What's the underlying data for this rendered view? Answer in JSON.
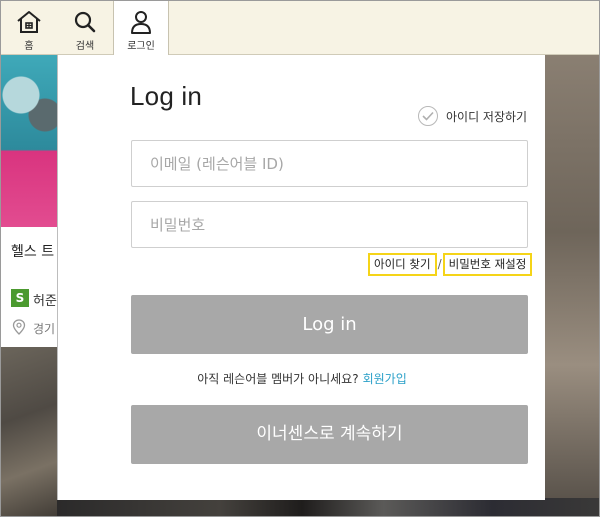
{
  "nav": {
    "tabs": [
      {
        "label": "홈",
        "icon": "home-icon"
      },
      {
        "label": "검색",
        "icon": "search-icon"
      },
      {
        "label": "로그인",
        "icon": "person-icon"
      }
    ]
  },
  "background": {
    "card_title": "헬스 트",
    "badge": "S",
    "place_name": "허준",
    "location": "경기"
  },
  "login": {
    "title": "Log in",
    "remember_label": "아이디 저장하기",
    "email_placeholder": "이메일 (레슨어블 ID)",
    "password_placeholder": "비밀번호",
    "find_id": "아이디 찾기",
    "separator": "/",
    "reset_password": "비밀번호 재설정",
    "login_button": "Log in",
    "not_member_text": "아직 레슨어블 멤버가 아니세요?",
    "signup_link": "회원가입",
    "continue_inner_button": "이너센스로 계속하기"
  },
  "colors": {
    "highlight_box": "#f5d418",
    "link": "#2aa0c8",
    "button": "#a8a8a8",
    "badge": "#4b9a2f"
  }
}
